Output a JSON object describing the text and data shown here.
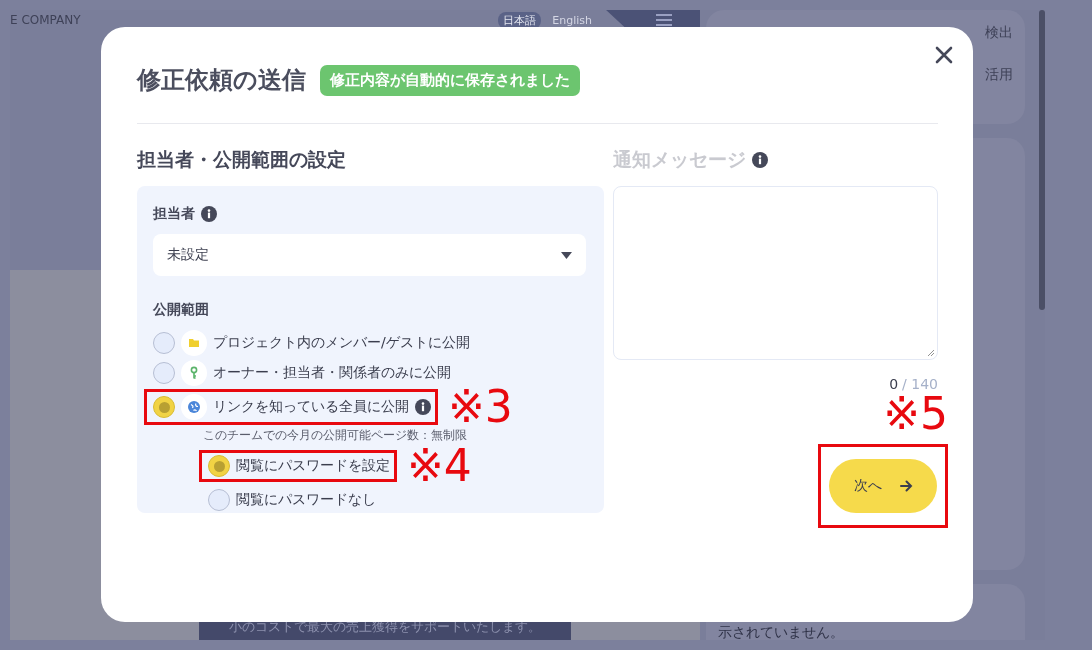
{
  "background": {
    "company": "E COMPANY",
    "languages": [
      {
        "label": "日本語",
        "selected": true
      },
      {
        "label": "English",
        "selected": false
      }
    ],
    "side_texts": [
      "検出",
      "活用"
    ],
    "card_text": "示されていません。",
    "banner_text": "小のコストで最大の売上獲得をサポートいたします。"
  },
  "dialog": {
    "title": "修正依頼の送信",
    "saved_badge": "修正内容が自動的に保存されました",
    "settings": {
      "heading": "担当者・公開範囲の設定",
      "assignee": {
        "label": "担当者",
        "value": "未設定"
      },
      "visibility": {
        "label": "公開範囲",
        "options": [
          {
            "kind": "folder",
            "label": "プロジェクト内のメンバー/ゲストに公開",
            "selected": false,
            "info": false
          },
          {
            "kind": "key",
            "label": "オーナー・担当者・関係者のみに公開",
            "selected": false,
            "info": false
          },
          {
            "kind": "link",
            "label": "リンクを知っている全員に公開",
            "selected": true,
            "info": true,
            "annotation": "※3",
            "note": "このチームでの今月の公開可能ページ数：無制限",
            "children": [
              {
                "label": "閲覧にパスワードを設定",
                "selected": true,
                "annotation": "※4"
              },
              {
                "label": "閲覧にパスワードなし",
                "selected": false
              }
            ]
          }
        ]
      }
    },
    "message": {
      "heading": "通知メッセージ",
      "count": "0",
      "limit": "/ 140"
    },
    "next_button": {
      "label": "次へ",
      "annotation": "※5"
    }
  }
}
